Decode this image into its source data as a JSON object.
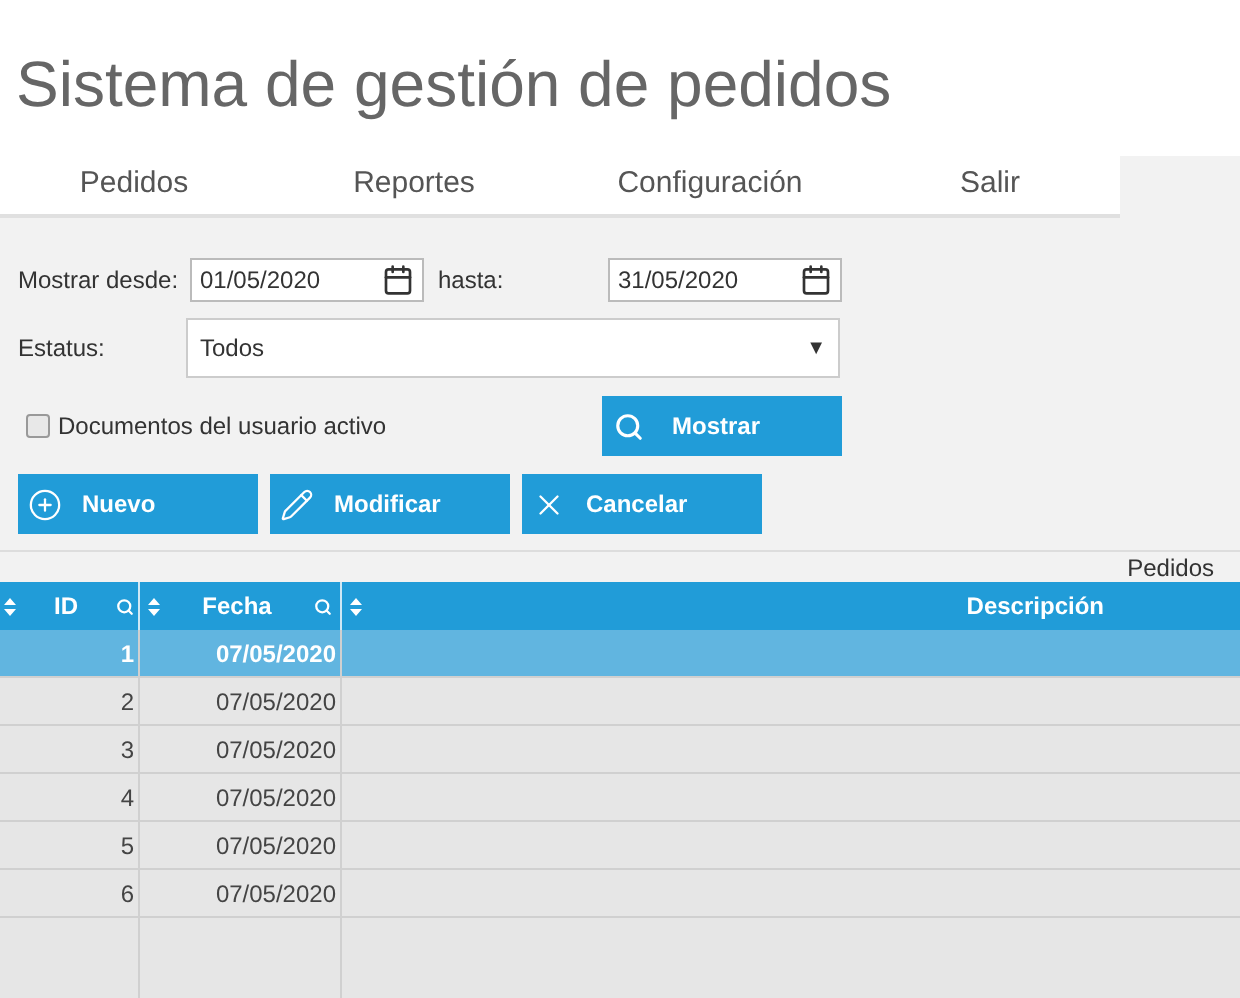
{
  "title": "Sistema de gestión de pedidos",
  "tabs": [
    {
      "label": "Pedidos"
    },
    {
      "label": "Reportes"
    },
    {
      "label": "Configuración"
    },
    {
      "label": "Salir"
    }
  ],
  "filters": {
    "from_label": "Mostrar desde:",
    "from_value": "01/05/2020",
    "to_label": "hasta:",
    "to_value": "31/05/2020",
    "status_label": "Estatus:",
    "status_value": "Todos",
    "dropdown_arrow": "▼",
    "checkbox": {
      "label": "Documentos del usuario activo",
      "checked": false
    },
    "show_button": "Mostrar"
  },
  "actions": [
    {
      "kind": "add",
      "label": "Nuevo"
    },
    {
      "kind": "edit",
      "label": "Modificar"
    },
    {
      "kind": "cancel",
      "label": "Cancelar"
    }
  ],
  "table": {
    "caption": "Pedidos",
    "columns": [
      "ID",
      "Fecha",
      "Descripción"
    ],
    "rows": [
      {
        "id": "1",
        "date": "07/05/2020",
        "selected": true
      },
      {
        "id": "2",
        "date": "07/05/2020",
        "selected": false
      },
      {
        "id": "3",
        "date": "07/05/2020",
        "selected": false
      },
      {
        "id": "4",
        "date": "07/05/2020",
        "selected": false
      },
      {
        "id": "5",
        "date": "07/05/2020",
        "selected": false
      },
      {
        "id": "6",
        "date": "07/05/2020",
        "selected": false
      }
    ]
  }
}
